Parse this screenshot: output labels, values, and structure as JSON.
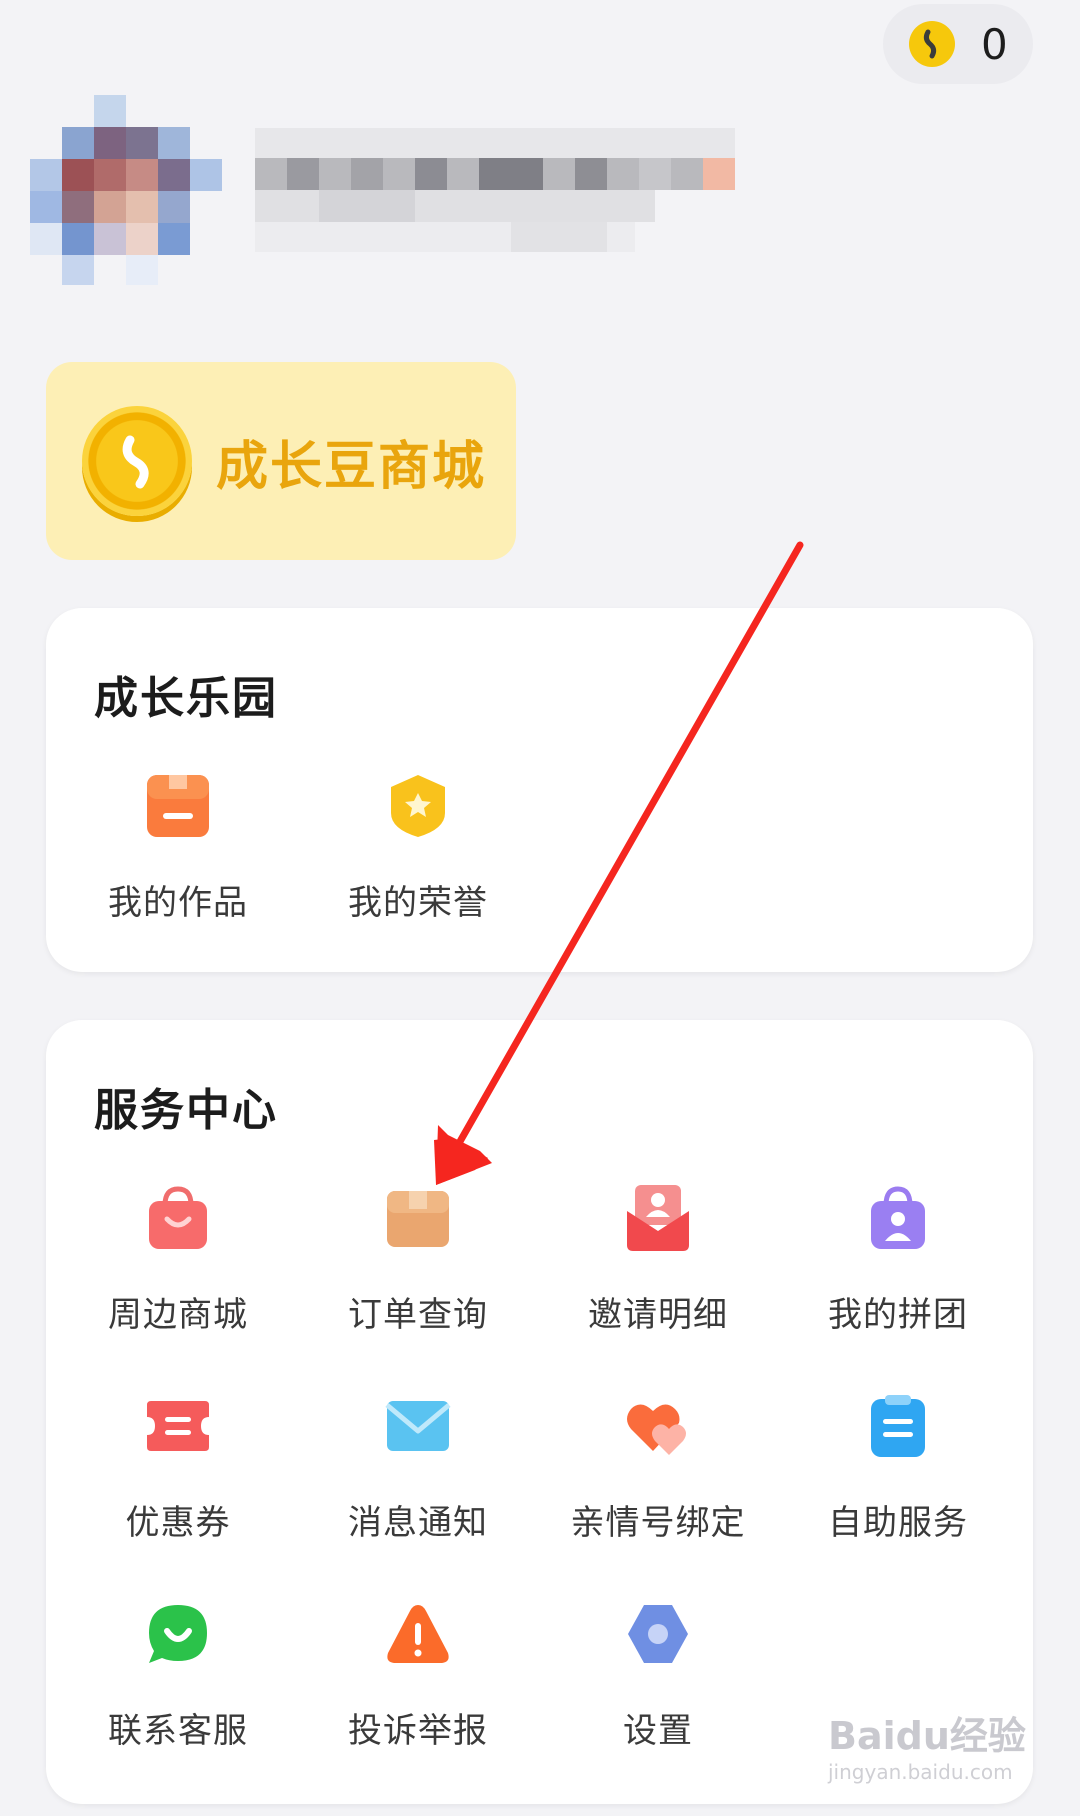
{
  "header": {
    "coin_count": "0"
  },
  "mall": {
    "label": "成长豆商城"
  },
  "growth_park": {
    "title": "成长乐园",
    "items": [
      {
        "label": "我的作品",
        "icon": "works-box-icon"
      },
      {
        "label": "我的荣誉",
        "icon": "honor-badge-icon"
      }
    ]
  },
  "service_center": {
    "title": "服务中心",
    "items": [
      {
        "label": "周边商城",
        "icon": "shopping-bag-icon"
      },
      {
        "label": "订单查询",
        "icon": "order-box-icon"
      },
      {
        "label": "邀请明细",
        "icon": "invite-envelope-icon"
      },
      {
        "label": "我的拼团",
        "icon": "group-buy-bag-icon"
      },
      {
        "label": "优惠券",
        "icon": "coupon-icon"
      },
      {
        "label": "消息通知",
        "icon": "message-mail-icon"
      },
      {
        "label": "亲情号绑定",
        "icon": "family-hearts-icon"
      },
      {
        "label": "自助服务",
        "icon": "self-service-clipboard-icon"
      },
      {
        "label": "联系客服",
        "icon": "chat-service-icon"
      },
      {
        "label": "投诉举报",
        "icon": "warning-triangle-icon"
      },
      {
        "label": "设置",
        "icon": "settings-hexagon-icon"
      }
    ]
  },
  "watermark": {
    "brand": "Baidu经验",
    "url": "jingyan.baidu.com"
  },
  "colors": {
    "page_bg": "#f3f3f6",
    "mall_bg": "#fdefb5",
    "mall_text": "#e9a50d",
    "annotation_arrow": "#f5261f"
  }
}
